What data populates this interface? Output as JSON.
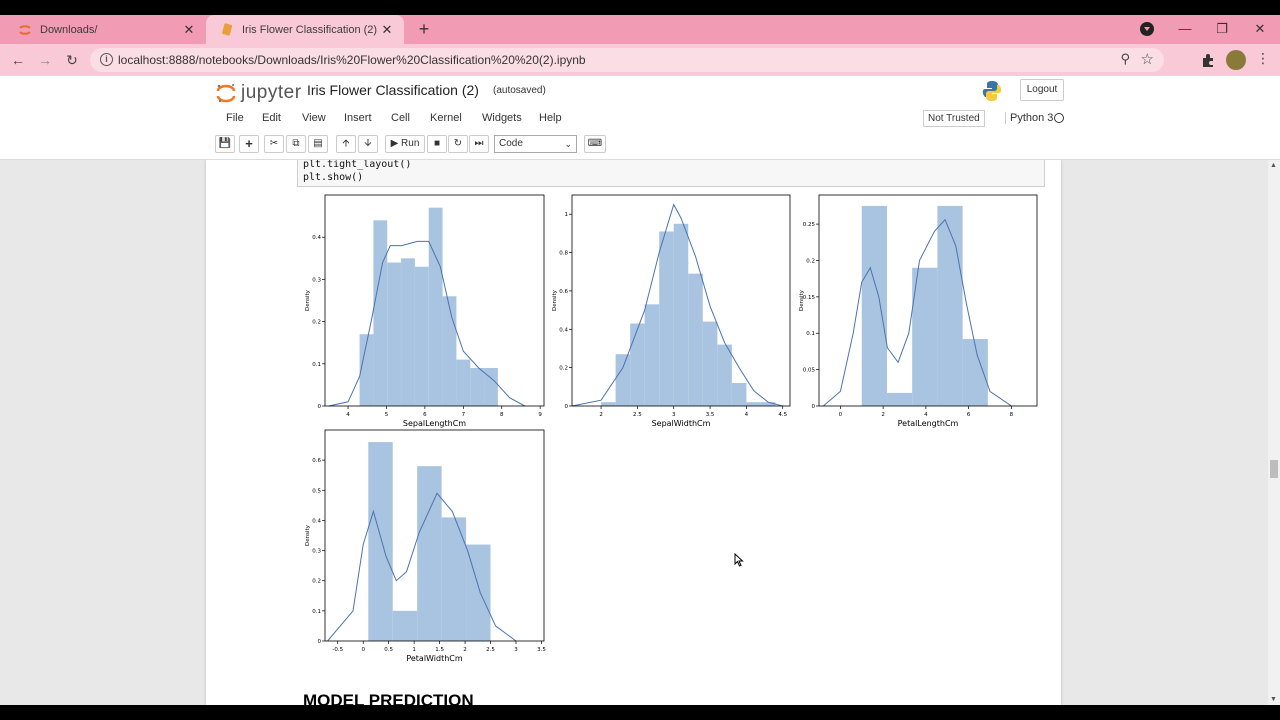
{
  "browser": {
    "tabs": [
      {
        "title": "Downloads/",
        "close": "✕"
      },
      {
        "title": "Iris Flower Classification (2) - Jupy",
        "close": "✕"
      }
    ],
    "new_tab": "+",
    "url": "localhost:8888/notebooks/Downloads/Iris%20Flower%20Classification%20%20(2).ipynb",
    "window_controls": {
      "minimize": "—",
      "restore": "❐",
      "close": "✕"
    }
  },
  "jupyter": {
    "logo_text": "jupyter",
    "notebook_name": "Iris Flower Classification (2)",
    "save_status": "(autosaved)",
    "logout_label": "Logout",
    "menu": [
      "File",
      "Edit",
      "View",
      "Insert",
      "Cell",
      "Kernel",
      "Widgets",
      "Help"
    ],
    "trust_status": "Not Trusted",
    "kernel_name": "Python 3",
    "run_label": "Run",
    "cell_type": "Code"
  },
  "code_lines": [
    "plt.tight_layout()",
    "plt.show()"
  ],
  "section_heading": "MODEL PREDICTION",
  "colors": {
    "bar": "#a9c4e0",
    "kde": "#4c72b0",
    "tab_strip": "#f29bb4",
    "active_tab": "#f9c9d7"
  },
  "chart_data": [
    {
      "type": "bar",
      "xlabel": "SepalLengthCm",
      "ylabel": "Density",
      "xlim": [
        3.4,
        9.1
      ],
      "ylim": [
        0,
        0.5
      ],
      "xticks": [
        4,
        5,
        6,
        7,
        8,
        9
      ],
      "yticks": [
        0.0,
        0.1,
        0.2,
        0.3,
        0.4
      ],
      "bins": [
        [
          4.3,
          4.66,
          0.17
        ],
        [
          4.66,
          5.02,
          0.44
        ],
        [
          5.02,
          5.38,
          0.34
        ],
        [
          5.38,
          5.74,
          0.35
        ],
        [
          5.74,
          6.1,
          0.33
        ],
        [
          6.1,
          6.46,
          0.47
        ],
        [
          6.46,
          6.82,
          0.26
        ],
        [
          6.82,
          7.18,
          0.11
        ],
        [
          7.18,
          7.54,
          0.09
        ],
        [
          7.54,
          7.9,
          0.09
        ]
      ],
      "kde": [
        [
          3.5,
          0.0
        ],
        [
          4.0,
          0.01
        ],
        [
          4.3,
          0.07
        ],
        [
          4.6,
          0.2
        ],
        [
          4.9,
          0.34
        ],
        [
          5.1,
          0.38
        ],
        [
          5.4,
          0.38
        ],
        [
          5.8,
          0.39
        ],
        [
          6.1,
          0.39
        ],
        [
          6.4,
          0.33
        ],
        [
          6.7,
          0.21
        ],
        [
          7.0,
          0.13
        ],
        [
          7.4,
          0.09
        ],
        [
          7.8,
          0.06
        ],
        [
          8.2,
          0.02
        ],
        [
          8.6,
          0.0
        ]
      ]
    },
    {
      "type": "bar",
      "xlabel": "SepalWidthCm",
      "ylabel": "Density",
      "xlim": [
        1.6,
        4.6
      ],
      "ylim": [
        0,
        1.1
      ],
      "xticks": [
        2.0,
        2.5,
        3.0,
        3.5,
        4.0,
        4.5
      ],
      "yticks": [
        0.0,
        0.2,
        0.4,
        0.6,
        0.8,
        1.0
      ],
      "bins": [
        [
          2.0,
          2.2,
          0.02
        ],
        [
          2.2,
          2.4,
          0.27
        ],
        [
          2.4,
          2.6,
          0.43
        ],
        [
          2.6,
          2.8,
          0.53
        ],
        [
          2.8,
          3.0,
          0.91
        ],
        [
          3.0,
          3.2,
          0.95
        ],
        [
          3.2,
          3.4,
          0.69
        ],
        [
          3.4,
          3.6,
          0.44
        ],
        [
          3.6,
          3.8,
          0.32
        ],
        [
          3.8,
          4.0,
          0.12
        ],
        [
          4.0,
          4.2,
          0.02
        ],
        [
          4.2,
          4.4,
          0.02
        ]
      ],
      "kde": [
        [
          1.6,
          0.0
        ],
        [
          2.0,
          0.03
        ],
        [
          2.3,
          0.2
        ],
        [
          2.6,
          0.5
        ],
        [
          2.8,
          0.8
        ],
        [
          3.0,
          1.05
        ],
        [
          3.1,
          0.98
        ],
        [
          3.3,
          0.78
        ],
        [
          3.5,
          0.52
        ],
        [
          3.7,
          0.33
        ],
        [
          3.9,
          0.2
        ],
        [
          4.1,
          0.08
        ],
        [
          4.3,
          0.02
        ],
        [
          4.5,
          0.0
        ]
      ]
    },
    {
      "type": "bar",
      "xlabel": "PetalLengthCm",
      "ylabel": "Density",
      "xlim": [
        -1.0,
        9.2
      ],
      "ylim": [
        0,
        0.29
      ],
      "xticks": [
        0,
        2,
        4,
        6,
        8
      ],
      "yticks": [
        0.0,
        0.05,
        0.1,
        0.15,
        0.2,
        0.25
      ],
      "bins": [
        [
          1.0,
          2.18,
          0.275
        ],
        [
          2.18,
          3.36,
          0.018
        ],
        [
          3.36,
          4.54,
          0.19
        ],
        [
          4.54,
          5.72,
          0.275
        ],
        [
          5.72,
          6.9,
          0.092
        ]
      ],
      "kde": [
        [
          -0.8,
          0.0
        ],
        [
          0.0,
          0.02
        ],
        [
          0.6,
          0.1
        ],
        [
          1.0,
          0.17
        ],
        [
          1.4,
          0.19
        ],
        [
          1.8,
          0.15
        ],
        [
          2.2,
          0.08
        ],
        [
          2.7,
          0.06
        ],
        [
          3.2,
          0.1
        ],
        [
          3.7,
          0.2
        ],
        [
          4.4,
          0.24
        ],
        [
          4.9,
          0.256
        ],
        [
          5.4,
          0.22
        ],
        [
          5.9,
          0.14
        ],
        [
          6.4,
          0.07
        ],
        [
          7.0,
          0.02
        ],
        [
          8.0,
          0.0
        ]
      ]
    },
    {
      "type": "bar",
      "xlabel": "PetalWidthCm",
      "ylabel": "Density",
      "xlim": [
        -0.75,
        3.55
      ],
      "ylim": [
        0,
        0.7
      ],
      "xticks": [
        -0.5,
        0.0,
        0.5,
        1.0,
        1.5,
        2.0,
        2.5,
        3.0,
        3.5
      ],
      "yticks": [
        0.0,
        0.1,
        0.2,
        0.3,
        0.4,
        0.5,
        0.6
      ],
      "bins": [
        [
          0.1,
          0.58,
          0.66
        ],
        [
          0.58,
          1.06,
          0.1
        ],
        [
          1.06,
          1.54,
          0.58
        ],
        [
          1.54,
          2.02,
          0.41
        ],
        [
          2.02,
          2.5,
          0.32
        ]
      ],
      "kde": [
        [
          -0.7,
          0.0
        ],
        [
          -0.2,
          0.1
        ],
        [
          0.0,
          0.32
        ],
        [
          0.2,
          0.43
        ],
        [
          0.45,
          0.28
        ],
        [
          0.65,
          0.2
        ],
        [
          0.85,
          0.23
        ],
        [
          1.1,
          0.36
        ],
        [
          1.45,
          0.49
        ],
        [
          1.75,
          0.43
        ],
        [
          2.05,
          0.3
        ],
        [
          2.3,
          0.16
        ],
        [
          2.6,
          0.05
        ],
        [
          3.0,
          0.0
        ]
      ]
    }
  ]
}
